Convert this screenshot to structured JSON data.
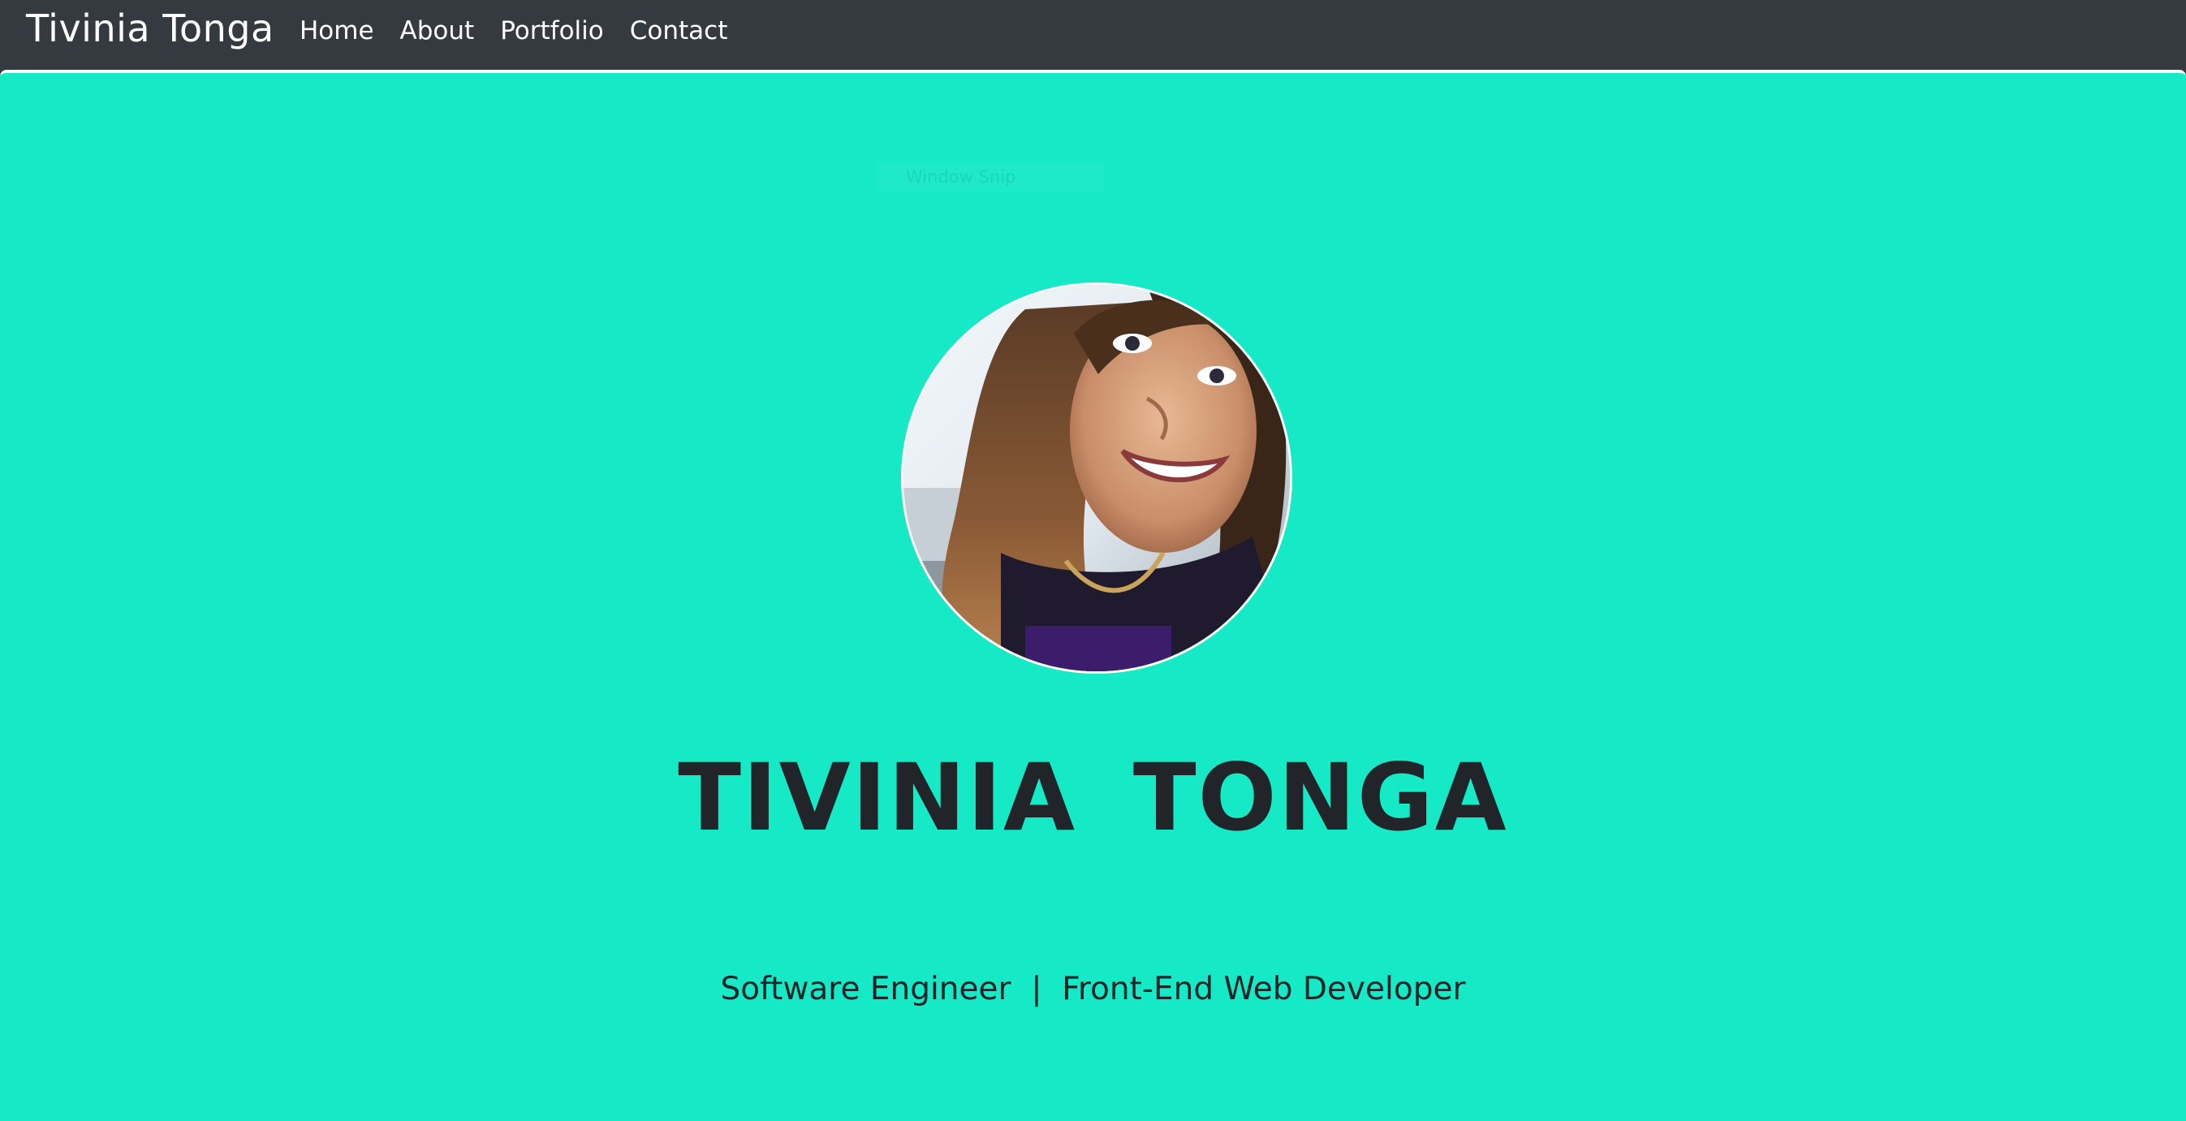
{
  "navbar": {
    "brand": "Tivinia Tonga",
    "links": [
      {
        "label": "Home"
      },
      {
        "label": "About"
      },
      {
        "label": "Portfolio"
      },
      {
        "label": "Contact"
      }
    ]
  },
  "hero": {
    "overlay_text": "Window Snip",
    "title": "TIVINIA  TONGA",
    "subtitle": "Software Engineer  |  Front-End Web Developer",
    "profile_image": "profile-photo"
  },
  "colors": {
    "navbar_bg": "#343a40",
    "hero_bg": "#15e9c6",
    "title_text": "#212529",
    "nav_text": "#ffffff"
  }
}
